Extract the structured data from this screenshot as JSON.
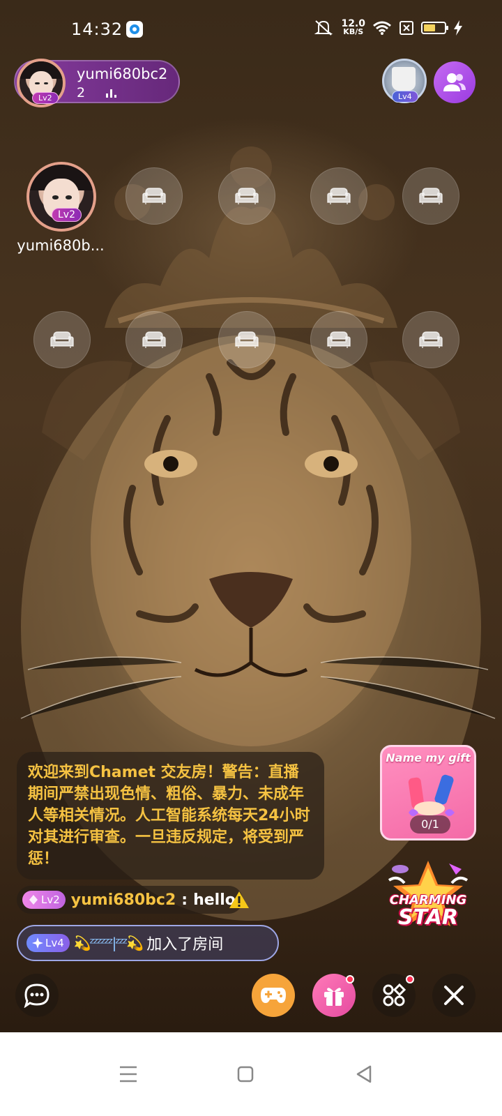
{
  "status_bar": {
    "time": "14:32",
    "net_speed_value": "12.0",
    "net_speed_unit": "KB/S"
  },
  "host": {
    "name": "yumi680bc2",
    "level": "Lv2",
    "viewer_count": "2"
  },
  "top_right": {
    "badge_level": "Lv4"
  },
  "seats": {
    "host_seat_name": "yumi680b...",
    "host_seat_level": "Lv2"
  },
  "welcome_message": "欢迎来到Chamet 交友房！警告：直播期间严禁出现色情、粗俗、暴力、未成年人等相关情况。人工智能系统每天24小时对其进行审查。一旦违反规定，将受到严惩！",
  "chat": {
    "level": "Lv2",
    "user": "yumi680bc2",
    "separator": ":",
    "message": "hello"
  },
  "join_notice": {
    "level": "Lv4",
    "name_deco": "💫ᶻᶻᶻᶻᶻᶻ|ᶻᶻᶻ💫",
    "text": "加入了房间"
  },
  "promo": {
    "gift_title": "Name my gift",
    "gift_progress": "0/1",
    "charm_line1": "CHARMING",
    "charm_line2": "STAR"
  },
  "colors": {
    "accent_gold": "#f5c242",
    "host_purple": "#8c3caa",
    "gift_pink": "#f46aa7",
    "game_orange": "#f6a43a"
  }
}
